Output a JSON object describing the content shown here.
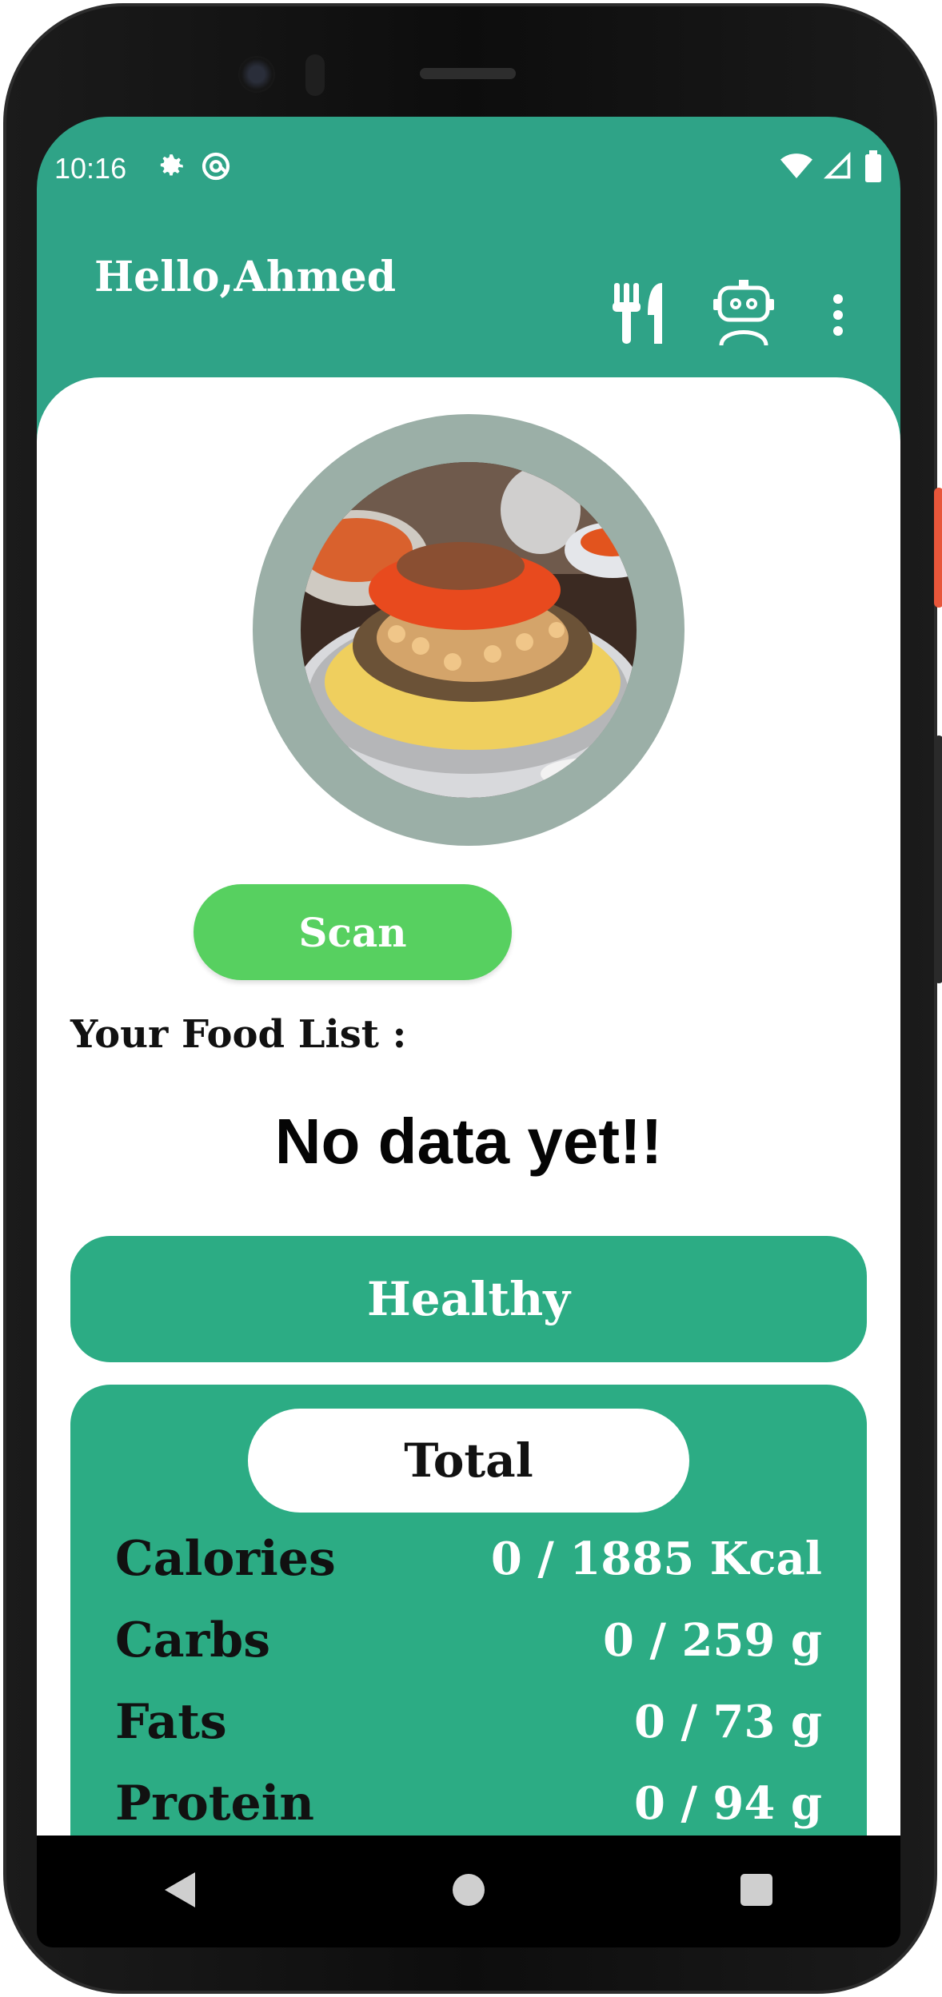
{
  "status_bar": {
    "time": "10:16",
    "icons": [
      "gear-icon",
      "at-sync-icon",
      "wifi-icon",
      "cell-signal-icon",
      "battery-icon"
    ]
  },
  "app_bar": {
    "greeting": "Hello,Ahmed",
    "icons": [
      "fork-knife-icon",
      "robot-icon",
      "more-vert-icon"
    ]
  },
  "main": {
    "scan_label": "Scan",
    "food_list_label": "Your Food List :",
    "empty_message": "No data yet!!",
    "healthy_label": "Healthy",
    "totals": {
      "title": "Total",
      "rows": [
        {
          "name": "Calories",
          "value": "0 / 1885 Kcal"
        },
        {
          "name": "Carbs",
          "value": "0 / 259 g"
        },
        {
          "name": "Fats",
          "value": "0 / 73 g"
        },
        {
          "name": "Protein",
          "value": "0 / 94 g"
        }
      ]
    }
  },
  "nav": {
    "buttons": [
      "back-icon",
      "home-icon",
      "recents-icon"
    ]
  },
  "colors": {
    "primary": "#2fa387",
    "scan_button": "#57d060",
    "avatar_ring": "#9bafa7"
  }
}
